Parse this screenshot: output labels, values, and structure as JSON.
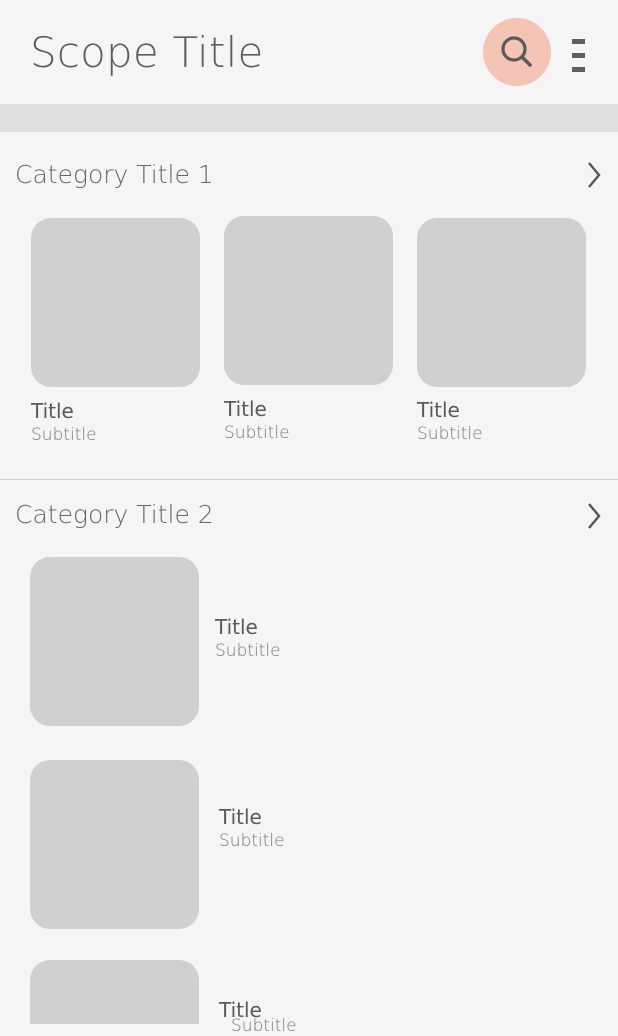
{
  "header": {
    "scope_title": "Scope Title",
    "search_icon": "search-icon",
    "menu_icon": "more-vert-icon"
  },
  "categories": [
    {
      "title": "Category Title 1",
      "items": [
        {
          "title": "Title",
          "subtitle": "Subtitle"
        },
        {
          "title": "Title",
          "subtitle": "Subtitle"
        },
        {
          "title": "Title",
          "subtitle": "Subtitle"
        }
      ]
    },
    {
      "title": "Category Title 2",
      "items": [
        {
          "title": "Title",
          "subtitle": "Subtitle"
        },
        {
          "title": "Title",
          "subtitle": "Subtitle"
        },
        {
          "title": "Title",
          "subtitle": "Subtitle"
        }
      ]
    }
  ],
  "colors": {
    "background": "#f5f5f5",
    "tile": "#d0d0d0",
    "search_highlight": "#f4c4b4",
    "band": "#dfdfdf"
  }
}
